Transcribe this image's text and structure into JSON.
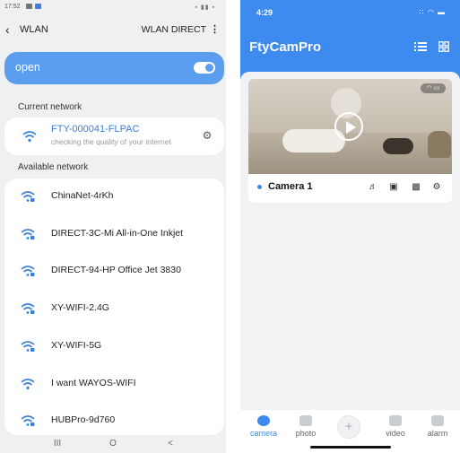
{
  "left_phone": {
    "status": {
      "time": "17:52",
      "right_icons": "▪ ▮▮ ▪"
    },
    "header": {
      "title": "WLAN",
      "direct": "WLAN DIRECT"
    },
    "toggle": {
      "label": "open",
      "state": "on"
    },
    "current_section": "Current network",
    "current_network": {
      "ssid": "FTY-000041-FLPAC",
      "status": "checking the quality of your internet"
    },
    "available_section": "Available network",
    "networks": [
      {
        "name": "ChinaNet-4rKh",
        "locked": true
      },
      {
        "name": "DIRECT-3C-Mi All-in-One Inkjet",
        "locked": true
      },
      {
        "name": "DIRECT-94-HP Office Jet 3830",
        "locked": true
      },
      {
        "name": "XY-WIFI-2.4G",
        "locked": true
      },
      {
        "name": "XY-WIFI-5G",
        "locked": true
      },
      {
        "name": "I want WAYOS-WIFI",
        "locked": false
      },
      {
        "name": "HUBPro-9d760",
        "locked": true
      }
    ],
    "nav": {
      "recent": "III",
      "home": "O",
      "back": "<"
    }
  },
  "right_phone": {
    "status": {
      "time": "4:29",
      "icons": "∶∶ ◠ ▬"
    },
    "app_title": "FtyCamPro",
    "camera_card": {
      "name": "Camera 1",
      "status_icons": "◠ ▭"
    },
    "tabs": [
      {
        "label": "camera",
        "active": true
      },
      {
        "label": "photo",
        "active": false
      },
      {
        "label": "video",
        "active": false
      },
      {
        "label": "alarm",
        "active": false
      }
    ],
    "add_label": "+",
    "colors": {
      "accent": "#3d8bef",
      "wlan_blue": "#5b9ef0"
    }
  }
}
